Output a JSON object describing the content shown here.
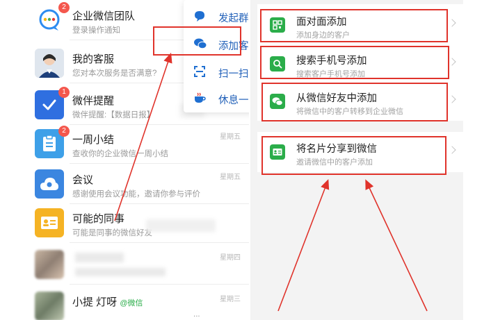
{
  "chat_list": {
    "items": [
      {
        "title": "企业微信团队",
        "subtitle": "登录操作通知",
        "time": "",
        "badge": "2",
        "avatar": "wecom-logo-icon"
      },
      {
        "title": "我的客服",
        "subtitle": "您对本次服务是否满意?",
        "time": "",
        "badge": "",
        "avatar": "agent-photo"
      },
      {
        "title": "微伴提醒",
        "subtitle": "微伴提醒:【数据日报】",
        "time": "",
        "badge": "1",
        "avatar": "checkmark-icon"
      },
      {
        "title": "一周小结",
        "subtitle": "查收你的企业微信一周小结",
        "time": "星期五",
        "badge": "2",
        "avatar": "clipboard-icon"
      },
      {
        "title": "会议",
        "subtitle": "感谢使用会议功能，邀请你参与评价",
        "time": "星期五",
        "badge": "",
        "avatar": "cloud-icon"
      },
      {
        "title": "可能的同事",
        "subtitle": "可能是同事的微信好友",
        "time": "",
        "badge": "",
        "avatar": "contact-card-icon"
      },
      {
        "title": "",
        "subtitle": "",
        "time": "星期四",
        "badge": "",
        "avatar": "blurred-photo"
      },
      {
        "title": "小提 灯呀",
        "subtitle": "...",
        "time": "星期三",
        "badge": "",
        "avatar": "blurred-photo",
        "tag": "@微信"
      }
    ]
  },
  "menu": {
    "items": [
      {
        "label": "发起群聊",
        "icon": "chat-bubble-icon"
      },
      {
        "label": "添加客户",
        "icon": "wechat-icon"
      },
      {
        "label": "扫一扫",
        "icon": "scan-icon"
      },
      {
        "label": "休息一下",
        "icon": "coffee-icon"
      }
    ]
  },
  "add_options": {
    "items": [
      {
        "title": "面对面添加",
        "subtitle": "添加身边的客户",
        "icon": "qr-code-icon"
      },
      {
        "title": "搜索手机号添加",
        "subtitle": "搜索客户手机号添加",
        "icon": "search-icon"
      },
      {
        "title": "从微信好友中添加",
        "subtitle": "将微信中的客户转移到企业微信",
        "icon": "wechat-icon"
      },
      {
        "title": "将名片分享到微信",
        "subtitle": "邀请微信中的客户添加",
        "icon": "business-card-icon"
      }
    ]
  },
  "colors": {
    "accent_blue": "#1f5fb8",
    "option_green": "#2bad4a",
    "annotation_red": "#e0332b",
    "badge_red": "#f4574d"
  }
}
